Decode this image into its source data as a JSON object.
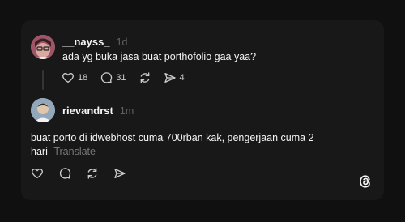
{
  "post": {
    "author": "__nayss_",
    "time": "1d",
    "text": "ada yg buka jasa buat porthofolio gaa yaa?",
    "likes": "18",
    "comments": "31",
    "shares": "4"
  },
  "reply": {
    "author": "rievandrst",
    "time": "1m",
    "text_line1": "buat porto di idwebhost cuma 700rban kak, pengerjaan cuma 2",
    "text_line2": "hari",
    "translate_label": "Translate"
  },
  "icons": {
    "like": "heart-icon",
    "comment": "comment-icon",
    "repost": "repost-icon",
    "share": "send-icon",
    "brand": "threads-logo-icon"
  },
  "colors": {
    "background": "#101010",
    "card": "#181818",
    "text": "#f3f5f7",
    "muted": "#616161"
  }
}
